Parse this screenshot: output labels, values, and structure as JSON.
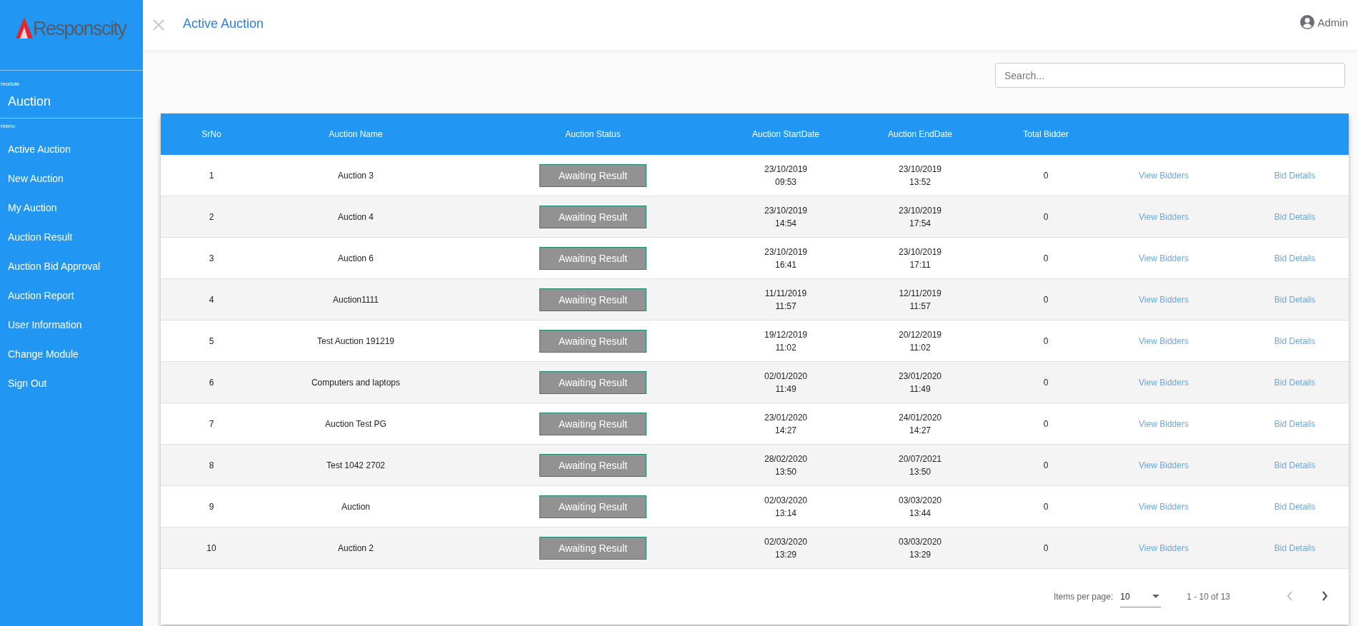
{
  "sidebar": {
    "logo": "Responscity",
    "module_label": "module",
    "module": "Auction",
    "menu_label": "menu",
    "items": [
      {
        "label": "Active Auction"
      },
      {
        "label": "New Auction"
      },
      {
        "label": "My Auction"
      },
      {
        "label": "Auction Result"
      },
      {
        "label": "Auction Bid Approval"
      },
      {
        "label": "Auction Report"
      },
      {
        "label": "User Information"
      },
      {
        "label": "Change Module"
      },
      {
        "label": "Sign Out"
      }
    ]
  },
  "header": {
    "title": "Active Auction",
    "user": "Admin"
  },
  "search": {
    "placeholder": "Search..."
  },
  "table": {
    "columns": [
      "SrNo",
      "Auction Name",
      "Auction Status",
      "Auction StartDate",
      "Auction EndDate",
      "Total Bidder"
    ],
    "rows": [
      {
        "srno": "1",
        "name": "Auction 3",
        "status": "Awaiting Result",
        "start_date": "23/10/2019",
        "start_time": "09:53",
        "end_date": "23/10/2019",
        "end_time": "13:52",
        "bidders": "0",
        "view": "View Bidders",
        "details": "Bid Details"
      },
      {
        "srno": "2",
        "name": "Auction 4",
        "status": "Awaiting Result",
        "start_date": "23/10/2019",
        "start_time": "14:54",
        "end_date": "23/10/2019",
        "end_time": "17:54",
        "bidders": "0",
        "view": "View Bidders",
        "details": "Bid Details"
      },
      {
        "srno": "3",
        "name": "Auction 6",
        "status": "Awaiting Result",
        "start_date": "23/10/2019",
        "start_time": "16:41",
        "end_date": "23/10/2019",
        "end_time": "17:11",
        "bidders": "0",
        "view": "View Bidders",
        "details": "Bid Details"
      },
      {
        "srno": "4",
        "name": "Auction1111",
        "status": "Awaiting Result",
        "start_date": "11/11/2019",
        "start_time": "11:57",
        "end_date": "12/11/2019",
        "end_time": "11:57",
        "bidders": "0",
        "view": "View Bidders",
        "details": "Bid Details"
      },
      {
        "srno": "5",
        "name": "Test Auction 191219",
        "status": "Awaiting Result",
        "start_date": "19/12/2019",
        "start_time": "11:02",
        "end_date": "20/12/2019",
        "end_time": "11:02",
        "bidders": "0",
        "view": "View Bidders",
        "details": "Bid Details"
      },
      {
        "srno": "6",
        "name": "Computers and laptops",
        "status": "Awaiting Result",
        "start_date": "02/01/2020",
        "start_time": "11:49",
        "end_date": "23/01/2020",
        "end_time": "11:49",
        "bidders": "0",
        "view": "View Bidders",
        "details": "Bid Details"
      },
      {
        "srno": "7",
        "name": "Auction Test PG",
        "status": "Awaiting Result",
        "start_date": "23/01/2020",
        "start_time": "14:27",
        "end_date": "24/01/2020",
        "end_time": "14:27",
        "bidders": "0",
        "view": "View Bidders",
        "details": "Bid Details"
      },
      {
        "srno": "8",
        "name": "Test 1042 2702",
        "status": "Awaiting Result",
        "start_date": "28/02/2020",
        "start_time": "13:50",
        "end_date": "20/07/2021",
        "end_time": "13:50",
        "bidders": "0",
        "view": "View Bidders",
        "details": "Bid Details"
      },
      {
        "srno": "9",
        "name": "Auction",
        "status": "Awaiting Result",
        "start_date": "02/03/2020",
        "start_time": "13:14",
        "end_date": "03/03/2020",
        "end_time": "13:44",
        "bidders": "0",
        "view": "View Bidders",
        "details": "Bid Details"
      },
      {
        "srno": "10",
        "name": "Auction 2",
        "status": "Awaiting Result",
        "start_date": "02/03/2020",
        "start_time": "13:29",
        "end_date": "03/03/2020",
        "end_time": "13:29",
        "bidders": "0",
        "view": "View Bidders",
        "details": "Bid Details"
      }
    ]
  },
  "paginator": {
    "items_label": "Items per page:",
    "page_size": "10",
    "range": "1 - 10 of 13",
    "prev_disabled": true,
    "next_disabled": false
  }
}
